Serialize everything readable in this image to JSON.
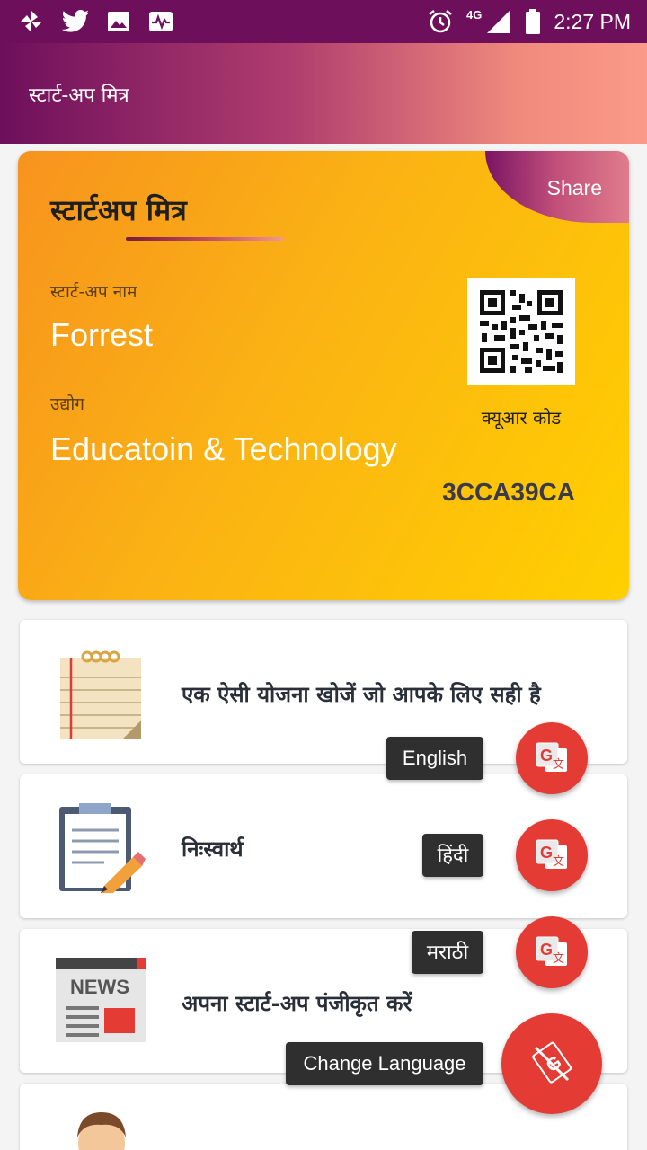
{
  "status_bar": {
    "network": "4G",
    "time": "2:27 PM"
  },
  "app_bar": {
    "title": "स्टार्ट-अप मित्र"
  },
  "id_card": {
    "title": "स्टार्टअप मित्र",
    "share_label": "Share",
    "startup_name_label": "स्टार्ट-अप नाम",
    "startup_name": "Forrest",
    "industry_label": "उद्योग",
    "industry": "Educatoin & Technology",
    "qr_label": "क्यूआर कोड",
    "code": "3CCA39CA"
  },
  "menu": {
    "items": [
      {
        "label": "एक ऐसी योजना खोजें जो आपके लिए सही है",
        "icon": "notepad-icon"
      },
      {
        "label": "निःस्वार्थ",
        "icon": "clipboard-pencil-icon"
      },
      {
        "label": "अपना स्टार्ट-अप पंजीकृत करें",
        "icon": "news-icon"
      },
      {
        "label": "",
        "icon": "person-avatar-icon"
      }
    ]
  },
  "language_menu": {
    "english_label": "English",
    "hindi_label": "हिंदी",
    "marathi_label": "मराठी",
    "change_label": "Change Language",
    "fab_color": "#e53b35"
  },
  "colors": {
    "status_bar": "#6e0f5c",
    "card_gradient_start": "#f7931e",
    "card_gradient_end": "#ffd000"
  }
}
